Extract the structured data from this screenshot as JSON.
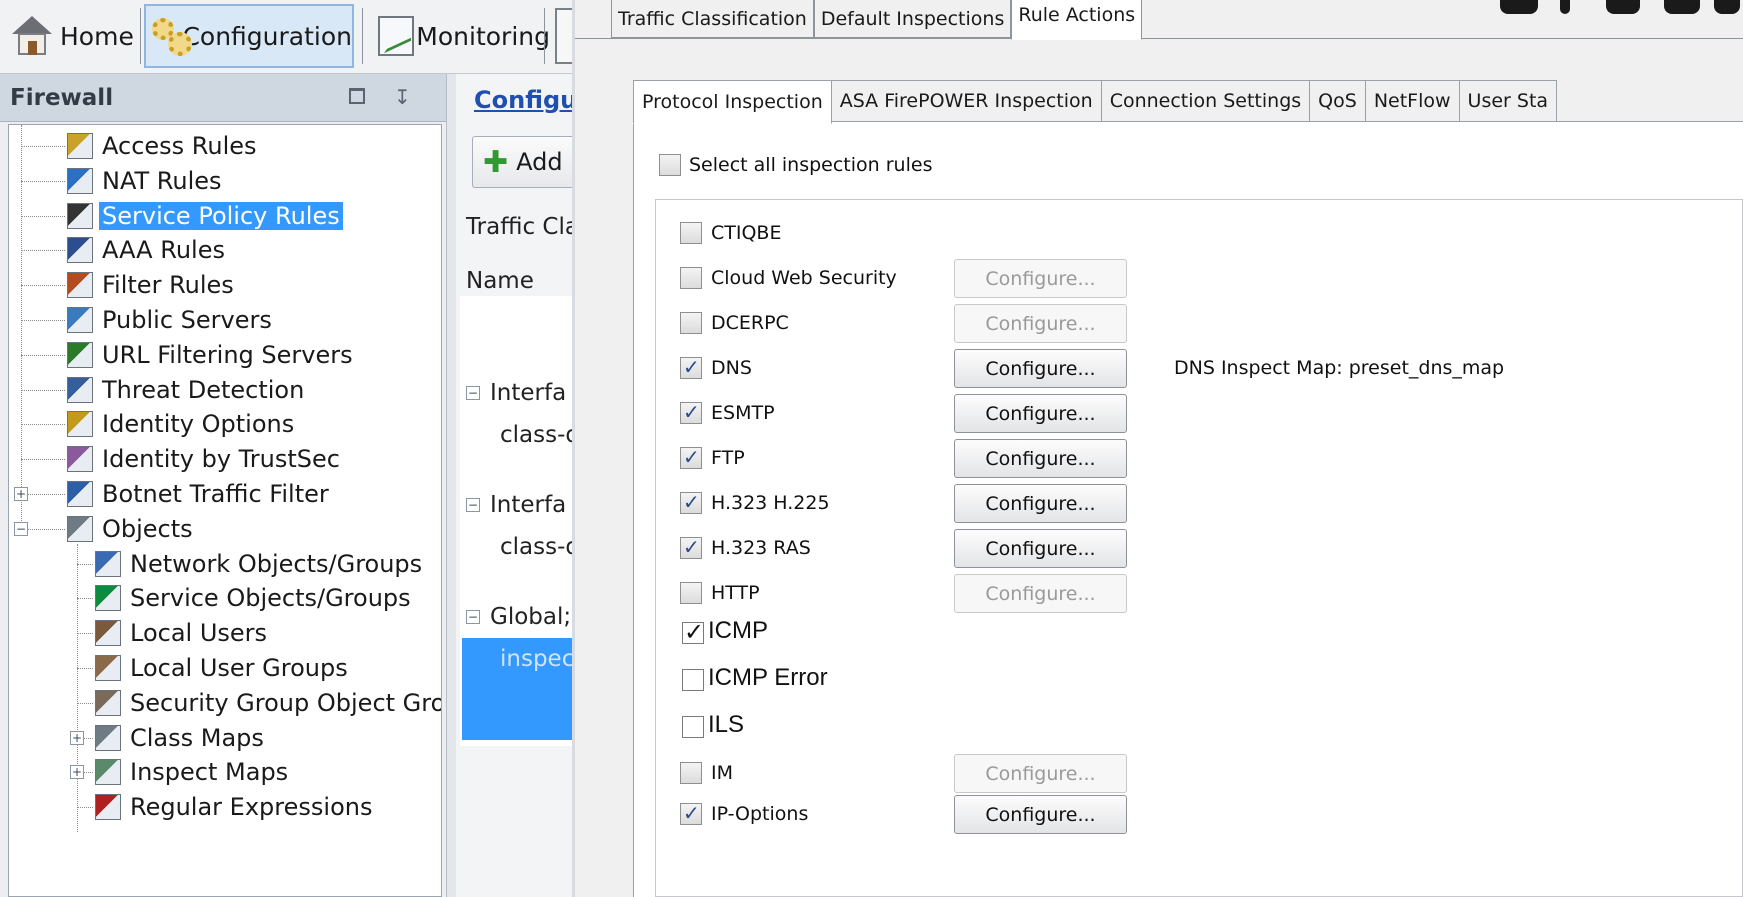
{
  "toolbar": {
    "home": "Home",
    "configuration": "Configuration",
    "monitoring": "Monitoring"
  },
  "firewall_panel": {
    "title": "Firewall",
    "items": [
      {
        "label": "Access Rules",
        "icon": "access-rules-icon"
      },
      {
        "label": "NAT Rules",
        "icon": "nat-rules-icon"
      },
      {
        "label": "Service Policy Rules",
        "icon": "service-policy-icon",
        "selected": true
      },
      {
        "label": "AAA Rules",
        "icon": "aaa-rules-icon"
      },
      {
        "label": "Filter Rules",
        "icon": "filter-rules-icon"
      },
      {
        "label": "Public Servers",
        "icon": "public-servers-icon"
      },
      {
        "label": "URL Filtering Servers",
        "icon": "url-filtering-icon"
      },
      {
        "label": "Threat Detection",
        "icon": "threat-detection-icon"
      },
      {
        "label": "Identity Options",
        "icon": "identity-options-icon"
      },
      {
        "label": "Identity by TrustSec",
        "icon": "trustsec-icon"
      },
      {
        "label": "Botnet Traffic Filter",
        "icon": "botnet-icon",
        "expander": "+"
      },
      {
        "label": "Objects",
        "icon": "objects-icon",
        "expander": "-"
      },
      {
        "label": "Network Objects/Groups",
        "icon": "network-objects-icon",
        "indent": 1
      },
      {
        "label": "Service Objects/Groups",
        "icon": "service-objects-icon",
        "indent": 1
      },
      {
        "label": "Local Users",
        "icon": "local-users-icon",
        "indent": 1
      },
      {
        "label": "Local User Groups",
        "icon": "local-user-groups-icon",
        "indent": 1
      },
      {
        "label": "Security Group Object Group",
        "icon": "security-group-icon",
        "indent": 1
      },
      {
        "label": "Class Maps",
        "icon": "class-maps-icon",
        "indent": 1,
        "expander": "+"
      },
      {
        "label": "Inspect Maps",
        "icon": "inspect-maps-icon",
        "indent": 1,
        "expander": "+"
      },
      {
        "label": "Regular Expressions",
        "icon": "regex-icon",
        "indent": 1
      }
    ]
  },
  "middle_panel": {
    "breadcrumb": "Configu",
    "add_button": "Add",
    "section_label": "Traffic Cla",
    "column_name": "Name",
    "rows": [
      {
        "text": "Interfa",
        "group": true
      },
      {
        "text": "class-d"
      },
      {
        "text": "Interfa",
        "group": true
      },
      {
        "text": "class-d"
      },
      {
        "text": "Global;",
        "group": true
      },
      {
        "text": "inspec",
        "selected": true
      }
    ]
  },
  "dialog": {
    "outer_tabs": [
      "Traffic Classification",
      "Default Inspections",
      "Rule Actions"
    ],
    "inner_tabs": [
      "Protocol Inspection",
      "ASA FirePOWER Inspection",
      "Connection Settings",
      "QoS",
      "NetFlow",
      "User Sta"
    ],
    "select_all_label": "Select all inspection rules",
    "configure_label": "Configure...",
    "rules": [
      {
        "name": "CTIQBE",
        "checked": false,
        "configure": "none"
      },
      {
        "name": "Cloud Web Security",
        "checked": false,
        "configure": "disabled"
      },
      {
        "name": "DCERPC",
        "checked": false,
        "configure": "disabled"
      },
      {
        "name": "DNS",
        "checked": true,
        "configure": "enabled",
        "note": "DNS Inspect Map: preset_dns_map"
      },
      {
        "name": "ESMTP",
        "checked": true,
        "configure": "enabled"
      },
      {
        "name": "FTP",
        "checked": true,
        "configure": "enabled"
      },
      {
        "name": "H.323 H.225",
        "checked": true,
        "configure": "enabled"
      },
      {
        "name": "H.323 RAS",
        "checked": true,
        "configure": "enabled"
      },
      {
        "name": "HTTP",
        "checked": false,
        "configure": "disabled"
      },
      {
        "name": "ICMP",
        "checked": true,
        "configure": "none",
        "style": "flat"
      },
      {
        "name": "ICMP Error",
        "checked": false,
        "configure": "none",
        "style": "flat"
      },
      {
        "name": "ILS",
        "checked": false,
        "configure": "none",
        "style": "flat"
      },
      {
        "name": "IM",
        "checked": false,
        "configure": "disabled"
      },
      {
        "name": "IP-Options",
        "checked": true,
        "configure": "enabled"
      }
    ]
  },
  "colors": {
    "selection": "#3399ff",
    "link": "#1f4fb0",
    "panel_header": "#cfd7e1"
  }
}
